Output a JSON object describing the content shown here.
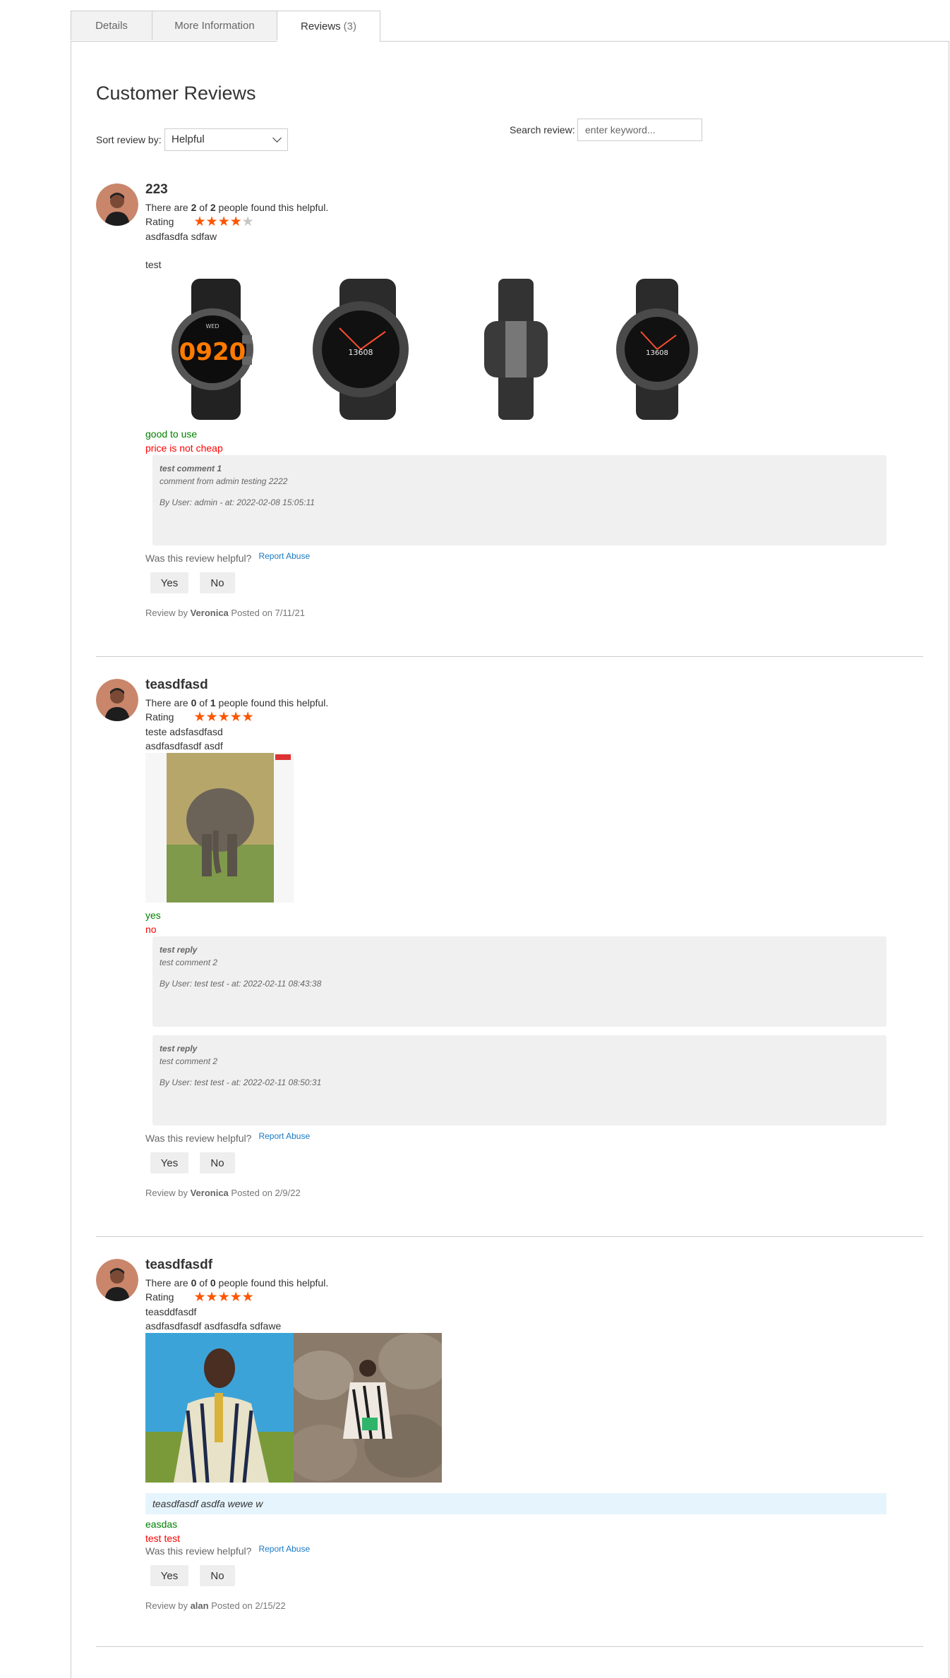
{
  "tabs": [
    {
      "label": "Details"
    },
    {
      "label": "More Information"
    },
    {
      "label": "Reviews",
      "count": "(3)"
    }
  ],
  "heading": "Customer Reviews",
  "sort": {
    "label": "Sort review by:",
    "value": "Helpful"
  },
  "search": {
    "label": "Search review:",
    "placeholder": "enter keyword..."
  },
  "helpful_question": "Was this review helpful?",
  "report_label": "Report Abuse",
  "yes_label": "Yes",
  "no_label": "No",
  "rating_label": "Rating",
  "colors": {
    "star": "#ff5501",
    "pro": "#008000",
    "con": "#ff0000",
    "link": "#1979c3"
  },
  "reviews": [
    {
      "title": "223",
      "helpful_pre": "There are ",
      "helpful_yes": "2",
      "helpful_mid": " of ",
      "helpful_total": "2",
      "helpful_post": " people found this helpful.",
      "stars": 4,
      "detail_1": "asdfasdfa sdfaw",
      "detail_2": "test",
      "images": [
        "smartwatch-front-icon",
        "smartwatch-angle-icon",
        "smartwatch-side-icon",
        "smartwatch-face-icon"
      ],
      "pro": "good to use",
      "con": "price is not cheap",
      "comments": [
        {
          "title": "test comment 1",
          "body": "comment from admin testing 2222",
          "user": "By User: admin - at: 2022-02-08 15:05:11"
        }
      ],
      "by_pre": "Review by ",
      "author": "Veronica",
      "posted": " Posted on 7/11/21"
    },
    {
      "title": "teasdfasd",
      "helpful_pre": "There are ",
      "helpful_yes": "0",
      "helpful_mid": " of ",
      "helpful_total": "1",
      "helpful_post": " people found this helpful.",
      "stars": 5,
      "detail_1": "teste adsfasdfasd",
      "detail_2": "asdfasdfasdf asdf",
      "images": [
        "elephant-painting-icon"
      ],
      "pro": "yes",
      "con": "no",
      "comments": [
        {
          "title": "test reply",
          "body": "test comment 2",
          "user": "By User: test test - at: 2022-02-11 08:43:38"
        },
        {
          "title": "test reply",
          "body": "test comment 2",
          "user": "By User: test test - at: 2022-02-11 08:50:31"
        }
      ],
      "by_pre": "Review by ",
      "author": "Veronica",
      "posted": " Posted on 2/9/22"
    },
    {
      "title": "teasdfasdf",
      "helpful_pre": "There are ",
      "helpful_yes": "0",
      "helpful_mid": " of ",
      "helpful_total": "0",
      "helpful_post": " people found this helpful.",
      "stars": 5,
      "detail_1": "teasddfasdf",
      "detail_2": "asdfasdfasdf asdfasdfa sdfawe",
      "images": [
        "fashion-photo-1-icon",
        "fashion-photo-2-icon"
      ],
      "reply": "teasdfasdf asdfa wewe w",
      "pro": "easdas",
      "con": "test test",
      "by_pre": "Review by ",
      "author": "alan",
      "posted": " Posted on 2/15/22"
    }
  ]
}
